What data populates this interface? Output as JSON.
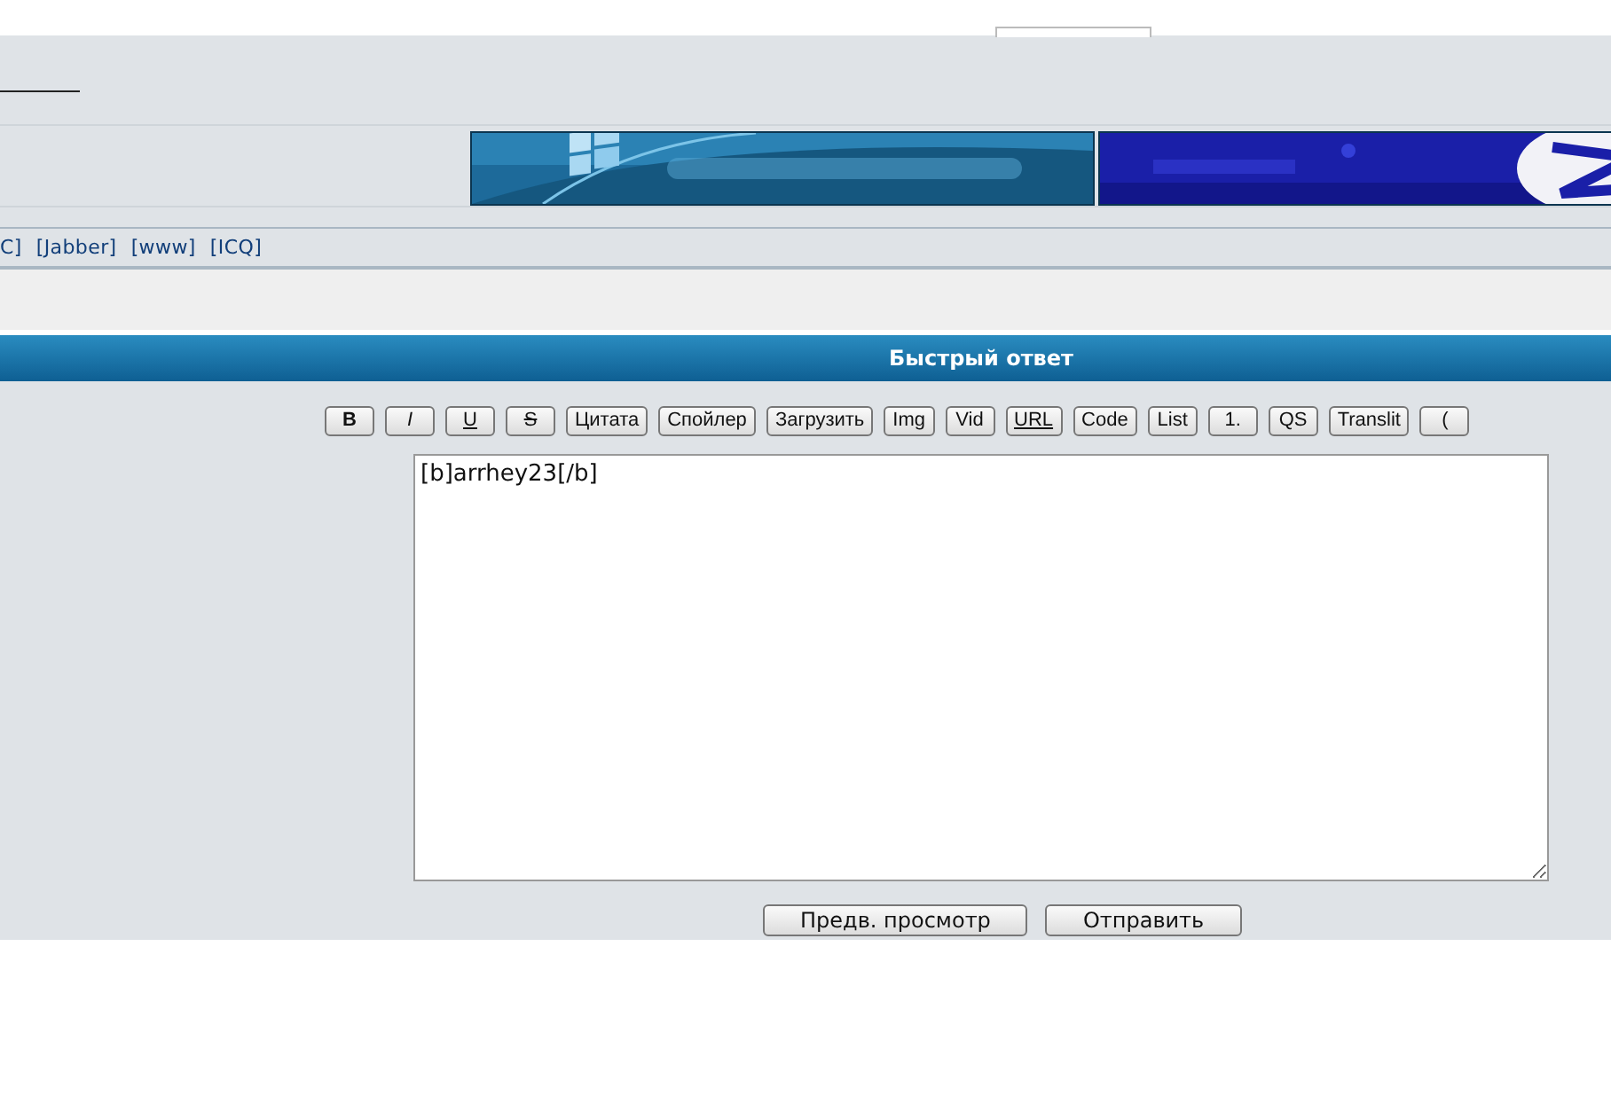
{
  "contact_links": [
    "C]",
    "[Jabber]",
    "[www]",
    "[ICQ]"
  ],
  "quick_reply": {
    "title": "Быстрый ответ",
    "toolbar": [
      {
        "label": "B",
        "kind": "bold"
      },
      {
        "label": "I",
        "kind": "italic"
      },
      {
        "label": "U",
        "kind": "underline"
      },
      {
        "label": "S",
        "kind": "strike"
      },
      {
        "label": "Цитата",
        "kind": "plain"
      },
      {
        "label": "Спойлер",
        "kind": "plain"
      },
      {
        "label": "Загрузить",
        "kind": "plain"
      },
      {
        "label": "Img",
        "kind": "plain"
      },
      {
        "label": "Vid",
        "kind": "plain"
      },
      {
        "label": "URL",
        "kind": "underline"
      },
      {
        "label": "Code",
        "kind": "plain"
      },
      {
        "label": "List",
        "kind": "plain"
      },
      {
        "label": "1.",
        "kind": "plain"
      },
      {
        "label": "QS",
        "kind": "plain"
      },
      {
        "label": "Translit",
        "kind": "plain"
      },
      {
        "label": "(",
        "kind": "plain"
      }
    ],
    "message": "[b]arrhey23[/b]",
    "buttons": [
      "Предв. просмотр",
      "Отправить"
    ]
  }
}
